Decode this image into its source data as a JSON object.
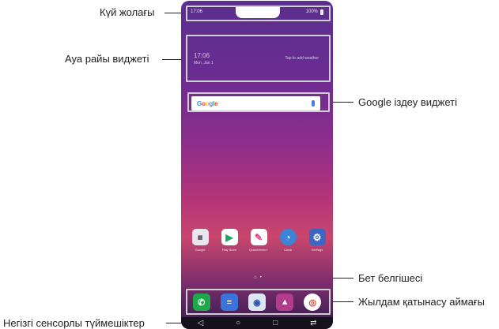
{
  "labels": {
    "status_bar": "Күй жолағы",
    "weather_widget": "Ауа райы виджеті",
    "google_search_widget": "Google іздеу виджеті",
    "page_indicator": "Бет белгішесі",
    "quick_access": "Жылдам қатынасу аймағы",
    "touch_buttons": "Негізгі сенсорлы түймешіктер"
  },
  "phone": {
    "status": {
      "left_text": "17:06",
      "right_text": "100%"
    },
    "weather": {
      "time": "17:06",
      "date": "Mon, Jan 1",
      "cta": "Tap to add weather"
    },
    "search": {
      "brand": "Google"
    },
    "apps": [
      {
        "label": "Google",
        "icon": "folder-icon",
        "color": "#e9e6ee"
      },
      {
        "label": "Play Store",
        "icon": "play-store-icon",
        "color": "#ffffff"
      },
      {
        "label": "QuickMemo+",
        "icon": "pen-icon",
        "color": "#e8418a"
      },
      {
        "label": "Clock",
        "icon": "clock-icon",
        "color": "#3d83d6"
      },
      {
        "label": "Settings",
        "icon": "gear-icon",
        "color": "#3d66c4"
      }
    ],
    "page_indicator": {
      "home": "⌂",
      "dot": "•"
    },
    "dock": [
      {
        "icon": "phone-icon",
        "color": "#1ea84a"
      },
      {
        "icon": "messages-icon",
        "color": "#3b74d8"
      },
      {
        "icon": "camera-icon",
        "color": "#2d53a8"
      },
      {
        "icon": "gallery-icon",
        "color": "#b13c8c"
      },
      {
        "icon": "chrome-icon",
        "color": "#ffffff"
      }
    ],
    "nav": {
      "back": "◁",
      "home": "○",
      "recents": "□",
      "dual": "⇄"
    }
  }
}
